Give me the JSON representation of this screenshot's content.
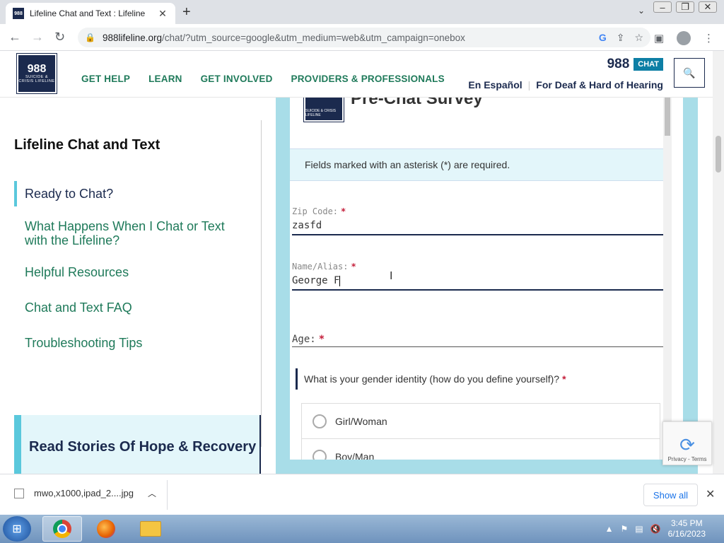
{
  "browser": {
    "tab_title": "Lifeline Chat and Text : Lifeline",
    "tab_favicon_text": "988",
    "url_host": "988lifeline.org",
    "url_path": "/chat/?utm_source=google&utm_medium=web&utm_campaign=onebox"
  },
  "header": {
    "logo_number": "988",
    "logo_sub": "SUICIDE & CRISIS LIFELINE",
    "nav": [
      "GET HELP",
      "LEARN",
      "GET INVOLVED",
      "PROVIDERS & PROFESSIONALS"
    ],
    "phone": "988",
    "chat_badge": "CHAT",
    "espanol": "En Español",
    "deaf": "For Deaf & Hard of Hearing"
  },
  "sidebar": {
    "title": "Lifeline Chat and Text",
    "items": [
      "Ready to Chat?",
      "What Happens When I Chat or Text with the Lifeline?",
      "Helpful Resources",
      "Chat and Text FAQ",
      "Troubleshooting Tips"
    ],
    "stories": "Read Stories Of Hope & Recovery"
  },
  "survey": {
    "logo_sub": "SUICIDE & CRISIS LIFELINE",
    "title": "Pre-Chat Survey",
    "required_note": "Fields marked with an asterisk (*) are required.",
    "zip_label": "Zip Code:",
    "zip_value": "zasfd",
    "name_label": "Name/Alias:",
    "name_value": "George F",
    "age_label": "Age:",
    "asterisk": "*",
    "gender_question": "What is your gender identity (how do you define yourself)?",
    "gender_options": [
      "Girl/Woman",
      "Boy/Man"
    ]
  },
  "recaptcha": {
    "terms": "Privacy - Terms"
  },
  "downloads": {
    "file": "mwo,x1000,ipad_2....jpg",
    "show_all": "Show all"
  },
  "taskbar": {
    "time": "3:45 PM",
    "date": "6/16/2023"
  }
}
